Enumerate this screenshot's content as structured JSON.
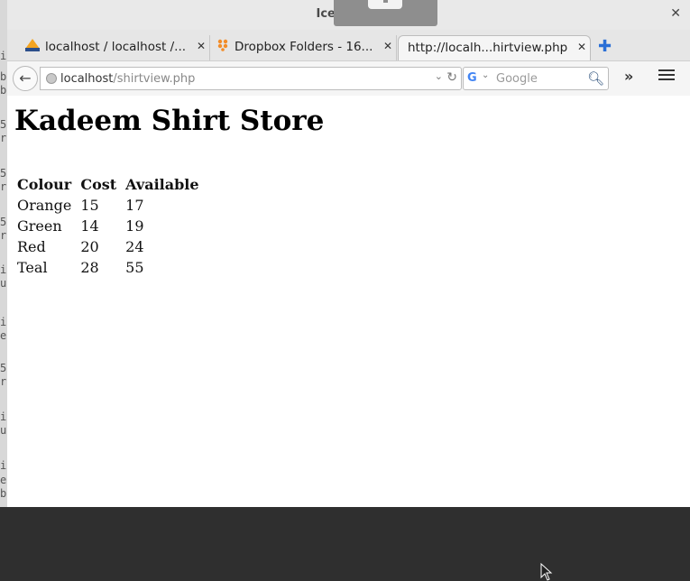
{
  "window": {
    "title": "Iceweasel"
  },
  "tabs": [
    {
      "label": "localhost / localhost /...",
      "icon": "phpmyadmin-icon"
    },
    {
      "label": "Dropbox Folders - 16...",
      "icon": "dropbox-icon"
    },
    {
      "label": "http://localh...hirtview.php",
      "icon": ""
    }
  ],
  "nav": {
    "url_host": "localhost",
    "url_path": "/shirtview.php",
    "search_placeholder": "Google"
  },
  "page": {
    "heading": "Kadeem Shirt Store",
    "columns": [
      "Colour",
      "Cost",
      "Available"
    ],
    "rows": [
      [
        "Orange",
        "15",
        "17"
      ],
      [
        "Green",
        "14",
        "19"
      ],
      [
        "Red",
        "20",
        "24"
      ],
      [
        "Teal",
        "28",
        "55"
      ]
    ]
  },
  "background_terminal": {
    "lines": [
      "it",
      "b",
      "b",
      "5",
      "r",
      "5",
      "r",
      "5",
      "r",
      "i",
      "u",
      "i",
      "e",
      "5",
      "r",
      "i",
      "u",
      "i",
      "e",
      "b"
    ]
  },
  "colors": {
    "accent": "#2a6fd6",
    "chrome": "#e9e9e9",
    "content_bg": "#ffffff"
  }
}
